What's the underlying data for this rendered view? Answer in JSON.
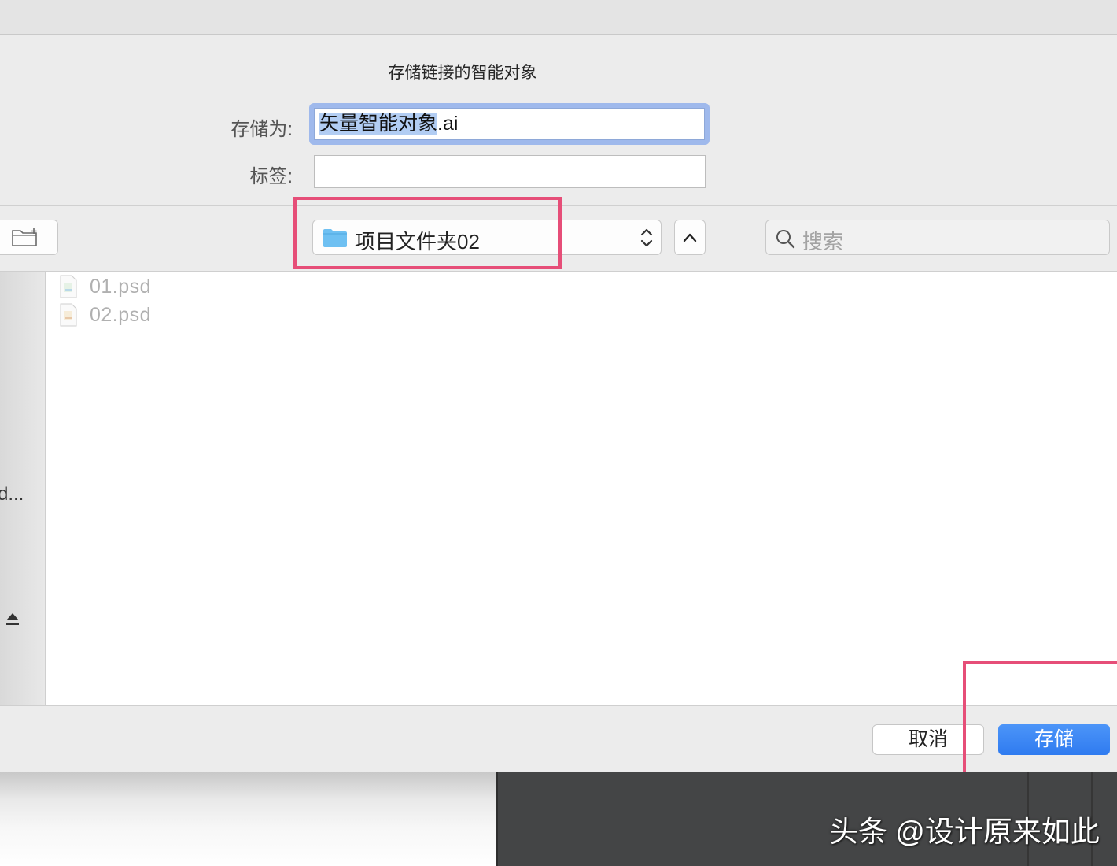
{
  "dialog": {
    "title": "存储链接的智能对象",
    "save_as_label": "存储为:",
    "filename_selected": "矢量智能对象",
    "filename_rest": ".ai",
    "tags_label": "标签:",
    "tags_value": ""
  },
  "toolbar": {
    "location": "项目文件夹02",
    "search_placeholder": "搜索"
  },
  "sidebar": {
    "truncated_item": "d..."
  },
  "files": [
    {
      "name": "01.psd"
    },
    {
      "name": "02.psd"
    }
  ],
  "buttons": {
    "cancel": "取消",
    "save": "存储"
  },
  "watermark": "头条 @设计原来如此",
  "colors": {
    "accent": "#2f7bf0",
    "highlight": "#e64e78",
    "folder": "#6ec0f2"
  }
}
